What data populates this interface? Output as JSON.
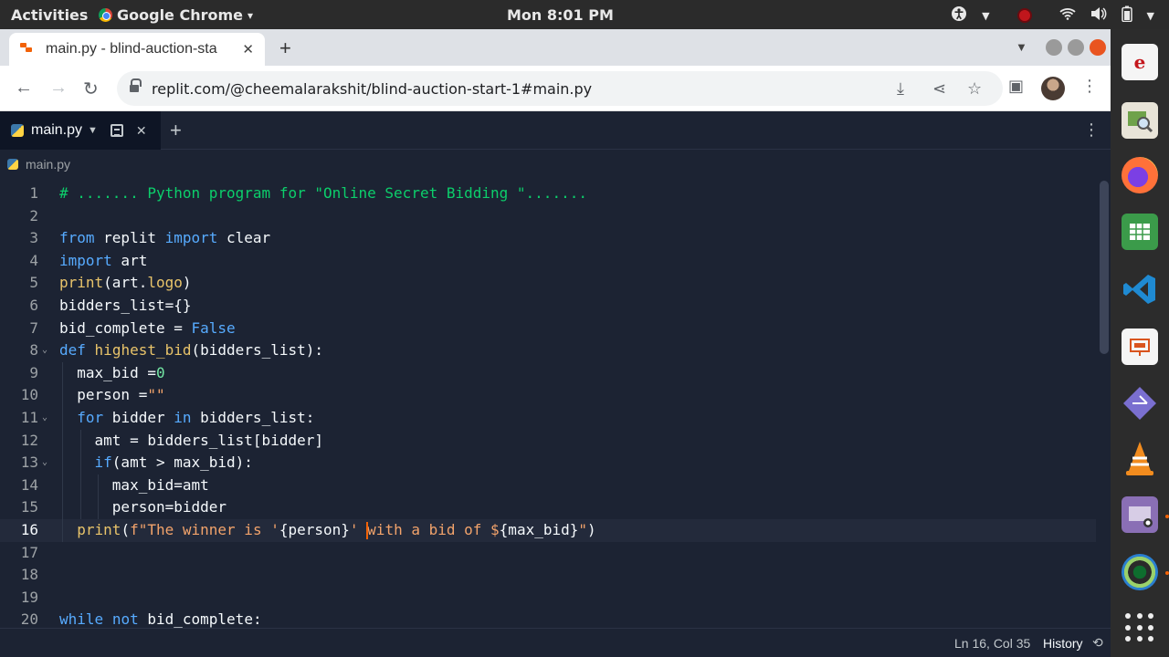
{
  "topbar": {
    "activities": "Activities",
    "app_name": "Google Chrome",
    "app_menu_arrow": "▾",
    "clock": "Mon  8:01 PM",
    "icons": [
      "accessibility-icon",
      "record-indicator-icon",
      "wifi-icon",
      "volume-icon",
      "battery-icon"
    ]
  },
  "browser": {
    "tab_title": "main.py - blind-auction-sta",
    "tab_close": "✕",
    "new_tab": "+",
    "url": "replit.com/@cheemalarakshit/blind-auction-start-1#main.py"
  },
  "editor": {
    "file_tab": "main.py",
    "breadcrumb": "main.py",
    "active_line": 16,
    "lines": [
      {
        "n": "1",
        "html": "<span style=\"color:#0cce6b\"># ....... Python program for \"Online Secret Bidding \".......</span>"
      },
      {
        "n": "2",
        "html": ""
      },
      {
        "n": "3",
        "html": "<span style=\"color:#57abff\">from</span> replit <span style=\"color:#57abff\">import</span> clear"
      },
      {
        "n": "4",
        "html": "<span style=\"color:#57abff\">import</span> art"
      },
      {
        "n": "5",
        "html": "<span style=\"color:#e9c46a\">print</span>(art.<span style=\"color:#e9c46a\">logo</span>)"
      },
      {
        "n": "6",
        "html": "bidders_list={}"
      },
      {
        "n": "7",
        "html": "bid_complete = <span style=\"color:#57abff\">False</span>"
      },
      {
        "n": "8",
        "html": "<span style=\"color:#57abff\">def</span> <span style=\"color:#e9c46a\">highest_bid</span>(bidders_list):"
      },
      {
        "n": "9",
        "html": "  max_bid =<span style=\"color:#73e7a4\">0</span>"
      },
      {
        "n": "10",
        "html": "  person =<span style=\"color:#f2a36b\">\"\"</span>"
      },
      {
        "n": "11",
        "html": "  <span style=\"color:#57abff\">for</span> bidder <span style=\"color:#57abff\">in</span> bidders_list:"
      },
      {
        "n": "12",
        "html": "    amt = bidders_list[bidder]"
      },
      {
        "n": "13",
        "html": "    <span style=\"color:#57abff\">if</span>(amt &gt; max_bid):"
      },
      {
        "n": "14",
        "html": "      max_bid=amt"
      },
      {
        "n": "15",
        "html": "      person=bidder"
      },
      {
        "n": "16",
        "html": "  <span style=\"color:#e9c46a\">print</span>(<span style=\"color:#f2a36b\">f\"The winner is '</span>{person}<span style=\"color:#f2a36b\">' with a bid of $</span>{max_bid}<span style=\"color:#f2a36b\">\"</span>)"
      },
      {
        "n": "17",
        "html": ""
      },
      {
        "n": "18",
        "html": ""
      },
      {
        "n": "19",
        "html": ""
      },
      {
        "n": "20",
        "html": "<span style=\"color:#57abff\">while</span> <span style=\"color:#57abff\">not</span> bid_complete:"
      }
    ],
    "folds": [
      8,
      11,
      13
    ],
    "status_position": "Ln 16, Col 35",
    "history_label": "History"
  },
  "dock": {
    "apps": [
      "evince-icon",
      "image-viewer-icon",
      "firefox-icon",
      "spreadsheet-icon",
      "vscode-icon",
      "presentation-icon",
      "git-app-icon",
      "vlc-icon",
      "screenshot-icon",
      "webcam-icon"
    ],
    "show_apps": "show-applications-icon"
  },
  "colors": {
    "editor_bg": "#1c2333",
    "accent": "#f26207"
  }
}
